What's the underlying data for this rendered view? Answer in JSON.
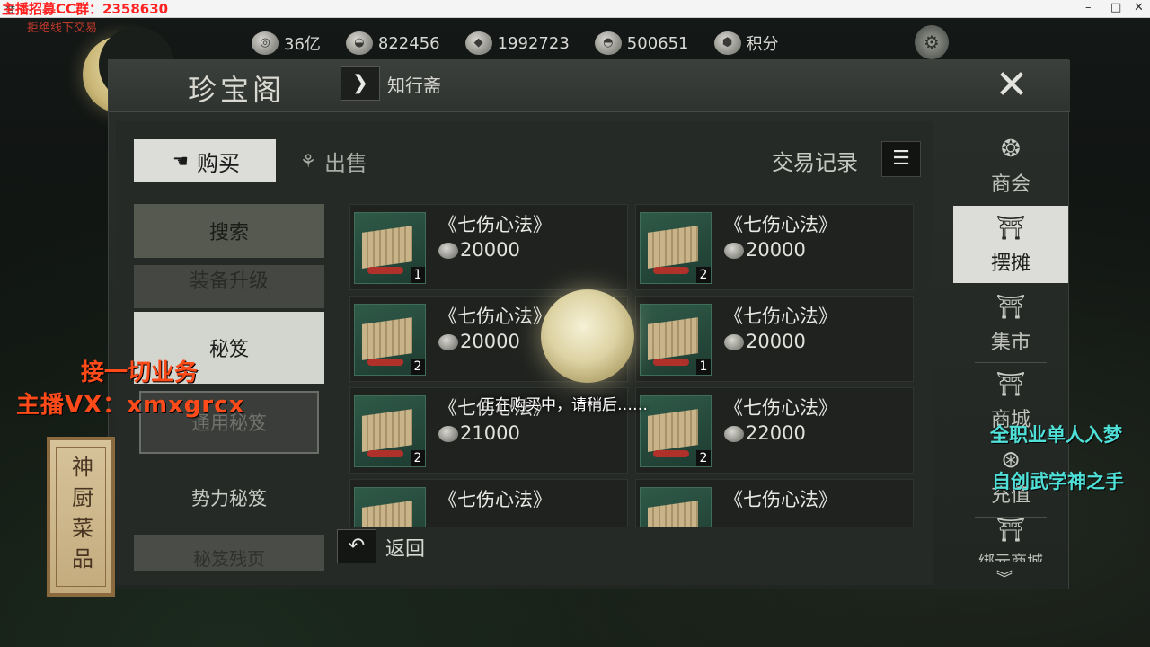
{
  "window": {
    "title": "梦",
    "controls": [
      "–",
      "□",
      "✕"
    ]
  },
  "overlays": {
    "top_red": "主播招募CC群：2358630",
    "top_sub": "拒绝线下交易",
    "business": "接一切业务",
    "vx": "主播VX：xmxgrcx",
    "cyan1": "全职业单人入梦",
    "cyan2": "自创武学神之手",
    "chef_sign": "神厨菜品"
  },
  "currency": [
    {
      "icon": "coin-icon",
      "value": "36亿"
    },
    {
      "icon": "silver-icon",
      "value": "822456"
    },
    {
      "icon": "jade-icon",
      "value": "1992723"
    },
    {
      "icon": "ingot-icon",
      "value": "500651"
    },
    {
      "icon": "points-icon",
      "value": "积分"
    }
  ],
  "header": {
    "title": "珍宝阁",
    "next_label": "知行斋"
  },
  "tabs": {
    "buy": "购买",
    "sell": "出售",
    "trade_log": "交易记录"
  },
  "categories": {
    "search": "搜索",
    "upgrade": "装备升级",
    "skill": "秘笈",
    "general": "通用秘笈",
    "faction": "势力秘笈",
    "more": "秘笈残页"
  },
  "items": [
    {
      "name": "《七伤心法》",
      "price": "20000",
      "qty": "1"
    },
    {
      "name": "《七伤心法》",
      "price": "20000",
      "qty": "2"
    },
    {
      "name": "《七伤心法》",
      "price": "20000",
      "qty": "2"
    },
    {
      "name": "《七伤心法》",
      "price": "20000",
      "qty": "1"
    },
    {
      "name": "《七伤心法》",
      "price": "21000",
      "qty": "2"
    },
    {
      "name": "《七伤心法》",
      "price": "22000",
      "qty": "2"
    },
    {
      "name": "《七伤心法》",
      "price": "",
      "qty": ""
    },
    {
      "name": "《七伤心法》",
      "price": "",
      "qty": ""
    }
  ],
  "back_label": "返回",
  "right_nav": [
    {
      "label": "商会",
      "icon": "guild-icon",
      "active": false
    },
    {
      "label": "摆摊",
      "icon": "stall-icon",
      "active": true
    },
    {
      "label": "集市",
      "icon": "market-icon",
      "active": false
    },
    {
      "label": "商城",
      "icon": "mall-icon",
      "active": false
    },
    {
      "label": "充值",
      "icon": "recharge-icon",
      "active": false
    },
    {
      "label": "绑元商城",
      "icon": "bound-mall-icon",
      "active": false
    }
  ],
  "loading_text": "正在购买中，请稍后……"
}
